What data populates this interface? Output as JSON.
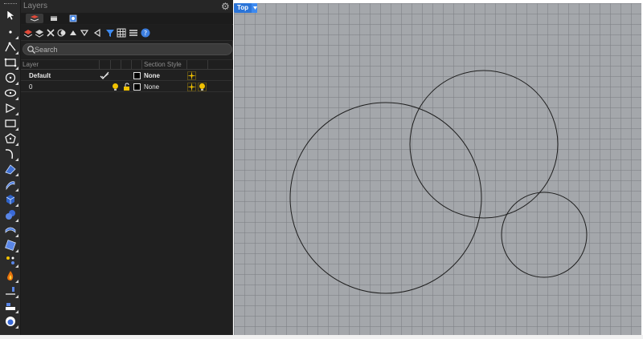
{
  "panel": {
    "title": "Layers",
    "search": {
      "placeholder": "Search",
      "value": ""
    },
    "columns": [
      "Layer",
      "Section Style"
    ],
    "rows": [
      {
        "name": "Default",
        "current": true,
        "section_style": "None",
        "bold": true
      },
      {
        "name": "0",
        "current": false,
        "section_style": "None",
        "bold": false
      }
    ]
  },
  "viewport": {
    "name": "Top",
    "curve_color": "#1e1e1e",
    "background": "#a4a7ab",
    "objects": [
      {
        "type": "circle",
        "label": "large-circle"
      },
      {
        "type": "circle",
        "label": "upper-circle"
      },
      {
        "type": "circle",
        "label": "small-circle"
      }
    ]
  },
  "icons": {
    "toolbar": [
      "select-arrow-icon",
      "point-icon",
      "polyline-icon",
      "rectangle-select-icon",
      "circle-tool-icon",
      "ellipse-icon",
      "polygon-icon",
      "rectangle-tool-icon",
      "polygon-center-icon",
      "curve-icon",
      "surface-icon",
      "extrude-icon",
      "box-solid-icon",
      "sphere-icon",
      "mesh-icon",
      "transform-icon",
      "explode-icon",
      "fire-icon",
      "dimension-icon",
      "drafting-icon",
      "render-icon"
    ],
    "panel_tools": [
      "new-layer-icon",
      "new-sublayer-icon",
      "delete-layer-icon",
      "duplicate-layer-icon",
      "move-up-icon",
      "move-down-icon",
      "move-left-icon",
      "filter-icon",
      "grid-view-icon",
      "list-view-icon",
      "help-icon"
    ]
  },
  "colors": {
    "accent": "#2a74d8",
    "panel_bg": "#202020",
    "toolbar_bg": "#2b2b2b",
    "light_on": "#f2c200"
  }
}
